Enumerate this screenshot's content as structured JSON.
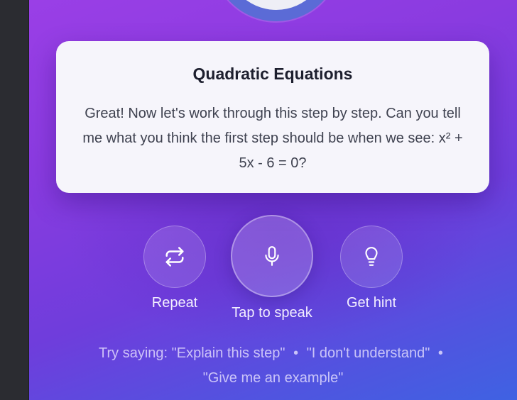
{
  "card": {
    "title": "Quadratic Equations",
    "message": "Great! Now let's work through this step by step. Can you tell me what you think the first step should be when we see: x² + 5x - 6 = 0?"
  },
  "controls": {
    "repeat_label": "Repeat",
    "speak_label": "Tap to speak",
    "hint_label": "Get hint"
  },
  "suggestions": {
    "prefix": "Try saying:",
    "items": [
      "\"Explain this step\"",
      "\"I don't understand\"",
      "\"Give me an example\""
    ],
    "separator": "•"
  },
  "colors": {
    "gradient_start": "#9a3fe6",
    "gradient_end": "#3f62e2",
    "card_bg": "#f6f5fb"
  },
  "icons": {
    "repeat": "repeat-icon",
    "mic": "microphone-icon",
    "hint": "lightbulb-icon"
  }
}
